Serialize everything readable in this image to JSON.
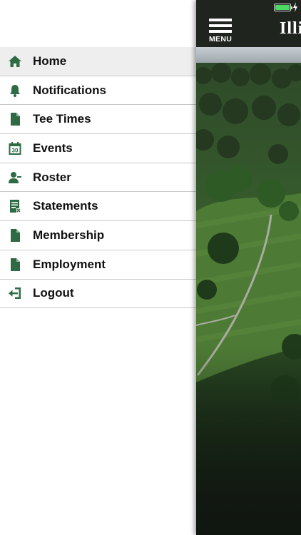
{
  "status_bar": {
    "battery_color": "#4cd964"
  },
  "drawer": {
    "accent_color": "#2e6b45",
    "items": [
      {
        "label": "Home",
        "icon": "home-icon",
        "active": true
      },
      {
        "label": "Notifications",
        "icon": "bell-icon",
        "active": false
      },
      {
        "label": "Tee Times",
        "icon": "document-icon",
        "active": false
      },
      {
        "label": "Events",
        "icon": "calendar-icon",
        "active": false
      },
      {
        "label": "Roster",
        "icon": "roster-icon",
        "active": false
      },
      {
        "label": "Statements",
        "icon": "statement-icon",
        "active": false
      },
      {
        "label": "Membership",
        "icon": "document-icon",
        "active": false
      },
      {
        "label": "Employment",
        "icon": "document-icon",
        "active": false
      },
      {
        "label": "Logout",
        "icon": "logout-icon",
        "active": false
      }
    ],
    "calendar_day": "30"
  },
  "header": {
    "menu_label": "MENU",
    "logo_text": "Illini"
  }
}
